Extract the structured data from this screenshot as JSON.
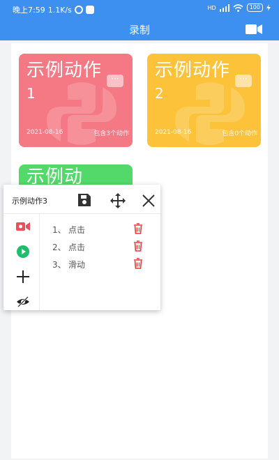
{
  "status_bar": {
    "time": "晚上7:59",
    "speed": "1.1K/s",
    "network": "HD",
    "battery": "100"
  },
  "header": {
    "title": "录制",
    "record_icon": "video-camera-icon"
  },
  "cards": [
    {
      "title_text": "示例动作",
      "title_num": "1",
      "date": "2021-08-16",
      "count": "包含3个动作",
      "more": "···",
      "color": "#f47984"
    },
    {
      "title_text": "示例动作",
      "title_num": "2",
      "date": "2021-08-16",
      "count": "包含0个动作",
      "more": "···",
      "color": "#fbc23a"
    },
    {
      "title_text": "示例动",
      "title_num": "",
      "date": "",
      "count": "",
      "more": "",
      "color": "#53d86a"
    }
  ],
  "panel": {
    "title": "示例动作3",
    "tools": [
      "save-icon",
      "move-icon",
      "close-icon"
    ],
    "side_buttons": [
      "record-icon",
      "play-icon",
      "add-icon",
      "eye-hide-icon"
    ],
    "steps": [
      {
        "num": "1、",
        "label": "点击"
      },
      {
        "num": "2、",
        "label": "点击"
      },
      {
        "num": "3、",
        "label": "滑动"
      }
    ]
  },
  "colors": {
    "primary": "#3d8ff0",
    "delete": "#e53935",
    "record": "#e8505b",
    "play": "#1ebe6b"
  }
}
